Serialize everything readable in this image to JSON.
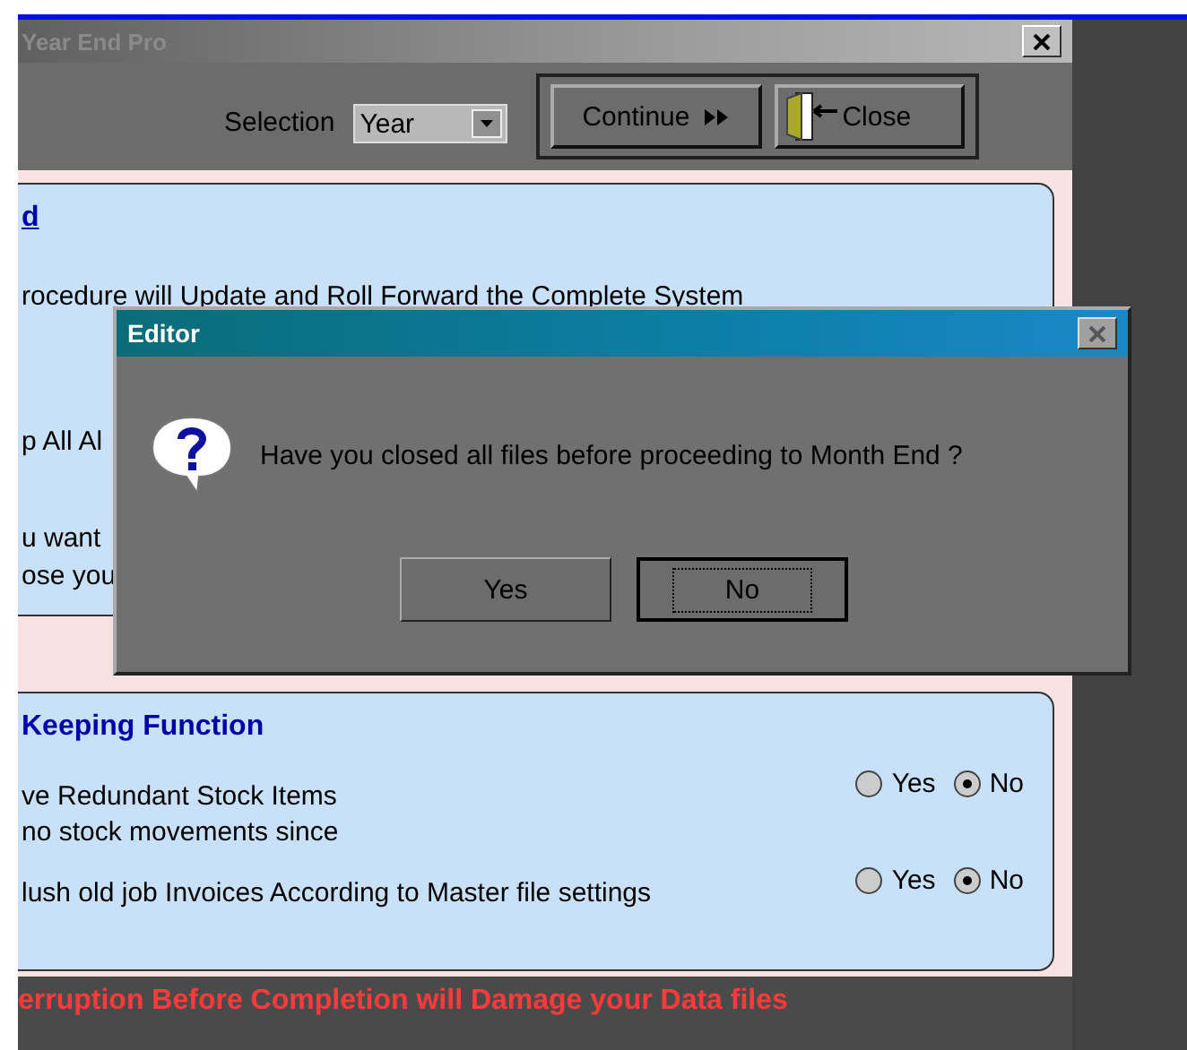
{
  "window": {
    "title": "Year End Pro"
  },
  "toolbar": {
    "selection_label": "Selection",
    "selection": {
      "value": "Year"
    },
    "buttons": [
      {
        "label": "Continue",
        "kind": "continue"
      },
      {
        "label": "Close",
        "kind": "close"
      }
    ]
  },
  "section_1": {
    "heading": "d",
    "paragraphs": [
      "rocedure will Update and Roll Forward the Complete System",
      "p All Al",
      "u want\nose you"
    ]
  },
  "section_2": {
    "heading": "Keeping Function",
    "options": [
      {
        "text": "ve Redundant Stock Items\nno stock movements since",
        "choices": [
          {
            "label": "Yes",
            "selected": false
          },
          {
            "label": "No",
            "selected": true
          }
        ]
      },
      {
        "text": "lush old job Invoices According to Master file settings",
        "choices": [
          {
            "label": "Yes",
            "selected": false
          },
          {
            "label": "No",
            "selected": true
          }
        ]
      }
    ]
  },
  "warning": "erruption Before Completion will Damage your Data files",
  "dialog": {
    "title": "Editor",
    "message": "Have you closed all files before proceeding to Month End ?",
    "buttons": [
      {
        "label": "Yes",
        "focused": false
      },
      {
        "label": "No",
        "focused": true
      }
    ]
  }
}
